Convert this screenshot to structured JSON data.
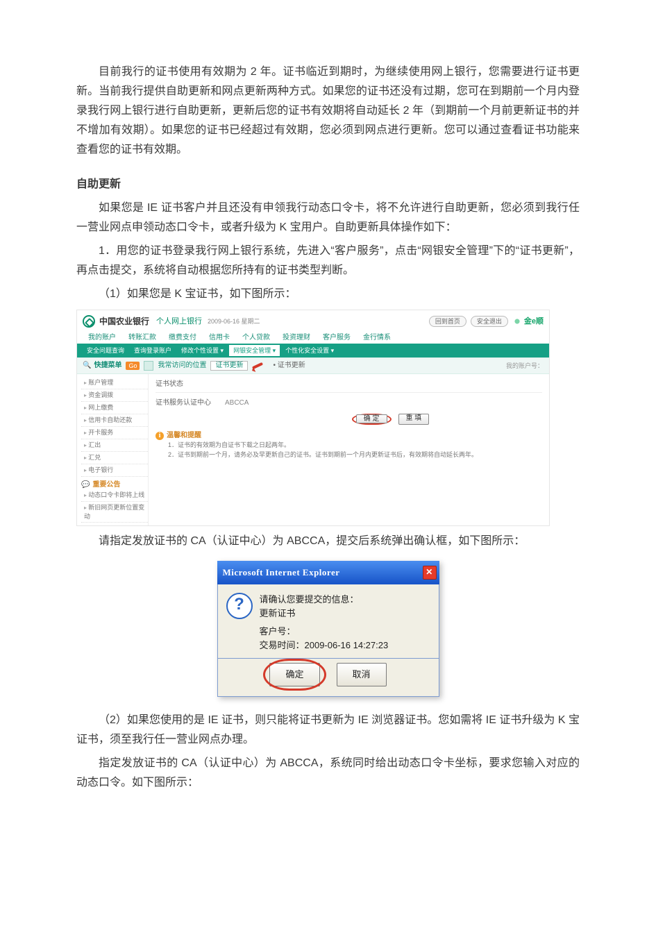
{
  "p1": "目前我行的证书使用有效期为 2 年。证书临近到期时，为继续使用网上银行，您需要进行证书更新。当前我行提供自助更新和网点更新两种方式。如果您的证书还没有过期，您可在到期前一个月内登录我行网上银行进行自助更新，更新后您的证书有效期将自动延长 2 年（到期前一个月前更新证书的并不增加有效期）。如果您的证书已经超过有效期，您必须到网点进行更新。您可以通过查看证书功能来查看您的证书有效期。",
  "h1": "自助更新",
  "p2": "如果您是 IE 证书客户并且还没有申领我行动态口令卡，将不允许进行自助更新，您必须到我行任一营业网点申领动态口令卡，或者升级为 K 宝用户。自助更新具体操作如下：",
  "p3": "1．用您的证书登录我行网上银行系统，先进入“客户服务”，点击“网银安全管理”下的“证书更新”，再点击提交，系统将自动根据您所持有的证书类型判断。",
  "p4": "（1）如果您是 K 宝证书，如下图所示：",
  "p5": "请指定发放证书的 CA（认证中心）为 ABCCA，提交后系统弹出确认框，如下图所示：",
  "p6": "（2）如果您使用的是 IE 证书，则只能将证书更新为 IE 浏览器证书。您如需将 IE 证书升级为 K 宝证书，须至我行任一营业网点办理。",
  "p7": "指定发放证书的 CA（认证中心）为 ABCCA，系统同时给出动态口令卡坐标，要求您输入对应的动态口令。如下图所示：",
  "bank": {
    "name": "中国农业银行",
    "sub": "个人网上银行",
    "date": "2009-06-16 星期二",
    "btn1": "回到首页",
    "btn2": "安全退出",
    "brand": "金e顺",
    "tabs": [
      "我的账户",
      "转账汇款",
      "缴费支付",
      "信用卡",
      "个人贷款",
      "投资理财",
      "客户服务",
      "金行情系"
    ],
    "subtabs": [
      "安全问题查询",
      "查询登录账户",
      "修改个性设置 ▾",
      "网银安全管理 ▾",
      "个性化安全设置 ▾"
    ],
    "subtab_active_index": 3,
    "quicknav": "快捷菜单",
    "go": "Go",
    "bc1": "我常访问的位置",
    "bc_active": "证书更新",
    "bc_plain": "• 证书更新",
    "acc": "我的账户号：",
    "side": [
      "账户管理",
      "资金调拨",
      "网上缴费",
      "信用卡自助还款",
      "开卡服务",
      "汇出",
      "汇兑",
      "电子银行"
    ],
    "side_group": "重要公告",
    "side2": [
      "动态口令卡即将上线",
      "新旧网页更新位置变动"
    ],
    "form_label1": "证书状态",
    "form_label2": "证书服务认证中心",
    "form_value2": "ABCCA",
    "btn_submit": "确 定",
    "btn_reset": "重 填",
    "hint_head": "温馨和提醒",
    "hint1": "1．证书的有效期为自证书下载之日起两年。",
    "hint2": "2．证书到期前一个月，请务必及早更新自己的证书。证书到期前一个月内更新证书后，有效期将自动延长两年。"
  },
  "dialog": {
    "title": "Microsoft Internet Explorer",
    "line1": "请确认您要提交的信息：",
    "line2": "更新证书",
    "line3": "客户号：",
    "line4": "交易时间：2009-06-16 14:27:23",
    "ok": "确定",
    "cancel": "取消"
  }
}
